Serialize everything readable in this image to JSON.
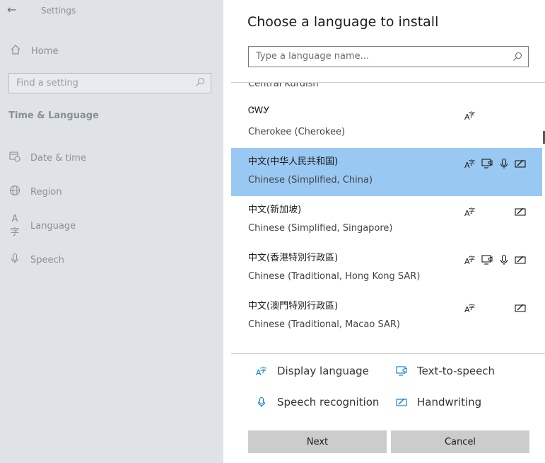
{
  "settings": {
    "title": "Settings",
    "back_icon": "back-arrow-icon",
    "home_label": "Home",
    "search_placeholder": "Find a setting",
    "section_title": "Time & Language",
    "nav": [
      {
        "label": "Date & time",
        "icon": "clock-calendar-icon"
      },
      {
        "label": "Region",
        "icon": "globe-icon"
      },
      {
        "label": "Language",
        "icon": "language-icon"
      },
      {
        "label": "Speech",
        "icon": "microphone-icon"
      }
    ]
  },
  "dialog": {
    "title": "Choose a language to install",
    "search_placeholder": "Type a language name...",
    "languages": [
      {
        "native": "",
        "english": "Central Kurdish",
        "features": [
          "display"
        ],
        "selected": false
      },
      {
        "native": "ᏣᎳᎩ",
        "english": "Cherokee (Cherokee)",
        "features": [
          "display"
        ],
        "selected": false
      },
      {
        "native": "中文(中华人民共和国)",
        "english": "Chinese (Simplified, China)",
        "features": [
          "display",
          "tts",
          "speech",
          "handwriting"
        ],
        "selected": true
      },
      {
        "native": "中文(新加坡)",
        "english": "Chinese (Simplified, Singapore)",
        "features": [
          "display",
          "handwriting"
        ],
        "selected": false
      },
      {
        "native": "中文(香港特別行政區)",
        "english": "Chinese (Traditional, Hong Kong SAR)",
        "features": [
          "display",
          "tts",
          "speech",
          "handwriting"
        ],
        "selected": false
      },
      {
        "native": "中文(澳門特別行政區)",
        "english": "Chinese (Traditional, Macao SAR)",
        "features": [
          "display",
          "handwriting"
        ],
        "selected": false
      }
    ],
    "legend": {
      "display": "Display language",
      "tts": "Text-to-speech",
      "speech": "Speech recognition",
      "handwriting": "Handwriting"
    },
    "buttons": {
      "next": "Next",
      "cancel": "Cancel"
    },
    "accent_color": "#0078d7",
    "selected_color": "#99c8f2"
  }
}
